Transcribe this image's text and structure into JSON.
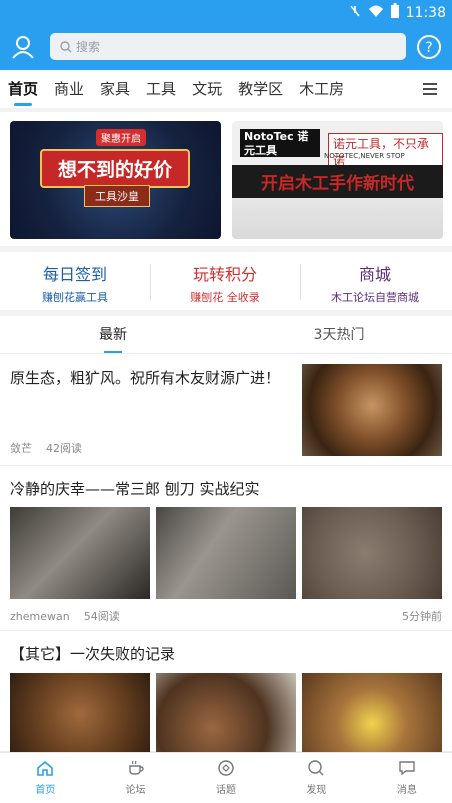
{
  "status_bar": {
    "time": "11:38"
  },
  "header": {
    "search_placeholder": "搜索"
  },
  "tabs": [
    "首页",
    "商业",
    "家具",
    "工具",
    "文玩",
    "教学区",
    "木工房"
  ],
  "banners": {
    "left": {
      "tag": "聚惠开启",
      "title": "想不到的好价",
      "subtitle": "工具沙皇"
    },
    "right": {
      "logo": "NotoTec 诺元工具",
      "slogan": "诺元工具，不只承诺",
      "sub": "NOTOTEC,NEVER STOP",
      "title": "开启木工手作新时代"
    }
  },
  "quick_links": [
    {
      "title": "每日签到",
      "sub": "赚刨花赢工具",
      "title_color": "#1a5ea8",
      "sub_color": "#1a5ea8"
    },
    {
      "title": "玩转积分",
      "sub": "赚刨花 全收录",
      "title_color": "#d32f2f",
      "sub_color": "#d32f2f"
    },
    {
      "title": "商城",
      "sub": "木工论坛自营商城",
      "title_color": "#5b2d7a",
      "sub_color": "#5b2d7a"
    }
  ],
  "feed_tabs": [
    "最新",
    "3天热门"
  ],
  "posts": [
    {
      "title": "原生态，粗犷风。祝所有木友财源广进！",
      "author": "敛芒",
      "reads": "42阅读"
    },
    {
      "title": "冷静的庆幸——常三郎 刨刀 实战纪实",
      "author": "zhemewan",
      "reads": "54阅读",
      "time": "5分钟前"
    },
    {
      "title": "【其它】一次失败的记录"
    }
  ],
  "bottom_nav": [
    "首页",
    "论坛",
    "话题",
    "发现",
    "消息"
  ],
  "colors": {
    "primary": "#2a9ff0"
  }
}
